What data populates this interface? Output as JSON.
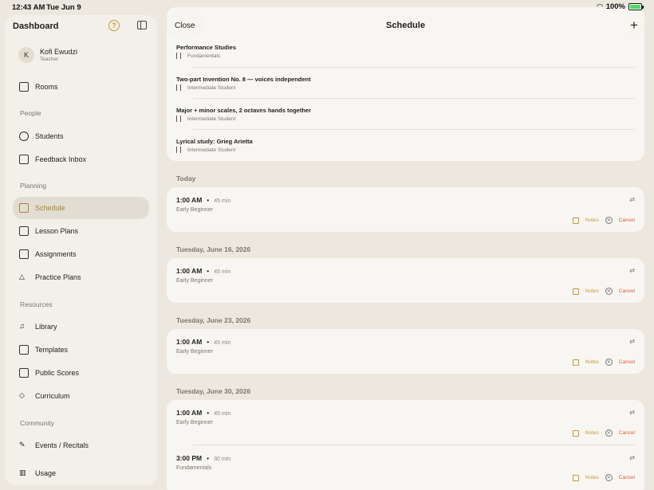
{
  "status_bar": {
    "time": "12:43 AM",
    "date": "Tue Jun 9",
    "battery": "100%"
  },
  "sidebar": {
    "title": "Dashboard",
    "help_icon": "question-circle-icon",
    "toggle_icon": "sidebar-toggle-icon",
    "profile": {
      "initial": "K",
      "name": "Kofi Ewudzi",
      "role": "Teacher"
    },
    "items": [
      {
        "label": "Rooms",
        "icon": "rooms-icon"
      },
      {
        "section": "People"
      },
      {
        "label": "Students",
        "icon": "people-icon"
      },
      {
        "label": "Feedback Inbox",
        "icon": "inbox-icon"
      },
      {
        "section": "Planning"
      },
      {
        "label": "Schedule",
        "icon": "calendar-icon",
        "active": true
      },
      {
        "label": "Lesson Plans",
        "icon": "list-icon"
      },
      {
        "label": "Assignments",
        "icon": "document-icon"
      },
      {
        "label": "Practice Plans",
        "icon": "triangle-icon"
      },
      {
        "section": "Resources"
      },
      {
        "label": "Library",
        "icon": "music-notes-icon"
      },
      {
        "label": "Templates",
        "icon": "grid-icon"
      },
      {
        "label": "Public Scores",
        "icon": "books-icon"
      },
      {
        "label": "Curriculum",
        "icon": "graduation-cap-icon"
      },
      {
        "section": "Community"
      },
      {
        "label": "Events / Recitals",
        "icon": "pen-icon"
      },
      {
        "label": "Usage",
        "icon": "bar-chart-icon"
      }
    ]
  },
  "main": {
    "close_label": "Close",
    "title": "Schedule",
    "add_icon": "plus-icon",
    "bits": [
      {
        "title": "Performance Studies",
        "level": "Fundamentals"
      },
      {
        "title": "Two-part Invention No. 8 — voices independent",
        "level": "Intermediate Student"
      },
      {
        "title": "Major + minor scales, 2 octaves hands together",
        "level": "Intermediate Student"
      },
      {
        "title": "Lyrical study: Grieg Arietta",
        "level": "Intermediate Student"
      }
    ],
    "days": [
      {
        "label": "Today",
        "slots": [
          {
            "time": "1:00 AM",
            "duration": "45 min",
            "level": "Early Beginner"
          }
        ]
      },
      {
        "label": "Tuesday, June 16, 2026",
        "slots": [
          {
            "time": "1:00 AM",
            "duration": "45 min",
            "level": "Early Beginner"
          }
        ]
      },
      {
        "label": "Tuesday, June 23, 2026",
        "slots": [
          {
            "time": "1:00 AM",
            "duration": "45 min",
            "level": "Early Beginner"
          }
        ]
      },
      {
        "label": "Tuesday, June 30, 2026",
        "slots": [
          {
            "time": "1:00 AM",
            "duration": "45 min",
            "level": "Early Beginner"
          },
          {
            "time": "3:00 PM",
            "duration": "30 min",
            "level": "Fundamentals"
          }
        ]
      }
    ],
    "action_labels": {
      "notes": "Notes",
      "cancel": "Cancel"
    },
    "separator": "•"
  }
}
